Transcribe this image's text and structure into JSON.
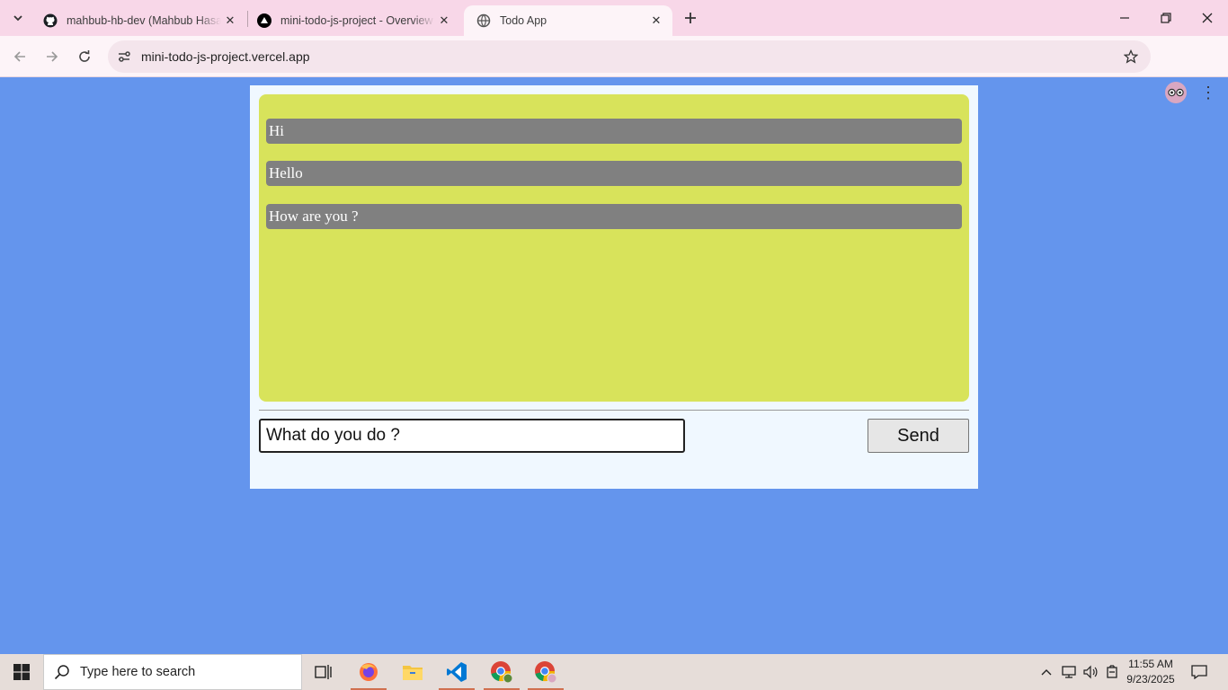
{
  "browser": {
    "tabs": [
      {
        "title": "mahbub-hb-dev (Mahbub Hasan)",
        "icon": "github-icon",
        "active": false
      },
      {
        "title": "mini-todo-js-project - Overview",
        "icon": "vercel-icon",
        "active": false
      },
      {
        "title": "Todo App",
        "icon": "globe-icon",
        "active": true
      }
    ],
    "url": "mini-todo-js-project.vercel.app"
  },
  "app": {
    "todos": [
      {
        "text": "Hi"
      },
      {
        "text": "Hello"
      },
      {
        "text": "How are you ?"
      }
    ],
    "input_value": "What do you do ?",
    "send_label": "Send",
    "colors": {
      "page_bg": "#6495ed",
      "container_bg": "#f0f8ff",
      "list_bg": "#d8e35b",
      "item_bg": "#808080"
    }
  },
  "taskbar": {
    "search_placeholder": "Type here to search",
    "apps": [
      "task-view-icon",
      "firefox-icon",
      "file-explorer-icon",
      "vscode-icon",
      "chrome-icon",
      "chrome-profile-icon"
    ],
    "time": "11:55 AM",
    "date": "9/23/2025"
  }
}
